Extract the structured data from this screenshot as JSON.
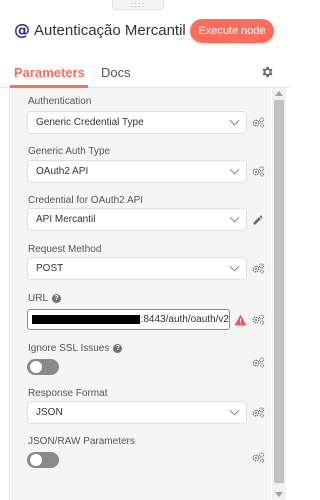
{
  "header": {
    "icon_glyph": "@",
    "icon_color": "#2a2b8f",
    "title": "Autenticação Mercantil",
    "execute_label": "Execute node",
    "execute_color": "#ff6d5a",
    "drag_handle_glyph": "::::"
  },
  "tabs": {
    "parameters": "Parameters",
    "docs": "Docs",
    "active": "parameters"
  },
  "fields": {
    "authentication": {
      "label": "Authentication",
      "value": "Generic Credential Type"
    },
    "generic_auth_type": {
      "label": "Generic Auth Type",
      "value": "OAuth2 API"
    },
    "credential": {
      "label": "Credential for OAuth2 API",
      "value": "API Mercantil"
    },
    "request_method": {
      "label": "Request Method",
      "value": "POST"
    },
    "url": {
      "label": "URL",
      "value_suffix": ":8443/auth/oauth/v2",
      "value_prefix_redacted": true,
      "has_warning": true
    },
    "ignore_ssl": {
      "label": "Ignore SSL Issues",
      "enabled": false
    },
    "response_format": {
      "label": "Response Format",
      "value": "JSON"
    },
    "json_raw": {
      "label": "JSON/RAW Parameters",
      "enabled": false
    }
  },
  "icons": {
    "param_options": "gears-icon",
    "edit_credential": "pencil-icon",
    "warning": "warning-triangle-icon",
    "settings": "gear-icon",
    "help": "question-circle-icon"
  }
}
